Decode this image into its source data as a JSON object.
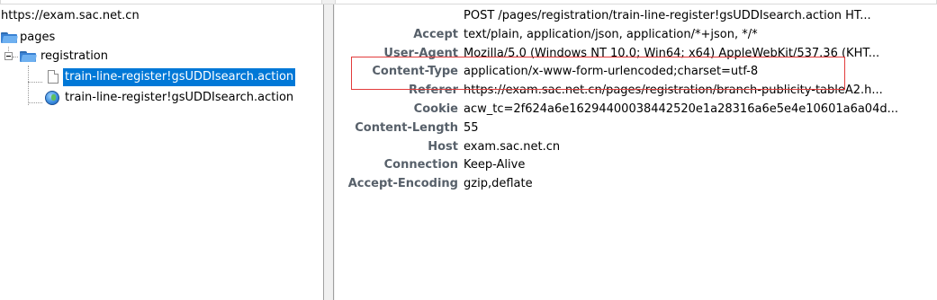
{
  "tree": {
    "root_label": "https://exam.sac.net.cn",
    "folder_pages": "pages",
    "folder_registration": "registration",
    "item_selected": "train-line-register!gsUDDIsearch.action",
    "item_second": "train-line-register!gsUDDIsearch.action"
  },
  "headers": [
    {
      "name": "",
      "value": "POST /pages/registration/train-line-register!gsUDDIsearch.action HT..."
    },
    {
      "name": "Accept",
      "value": "text/plain, application/json, application/*+json, */*"
    },
    {
      "name": "User-Agent",
      "value": "Mozilla/5.0 (Windows NT 10.0; Win64; x64) AppleWebKit/537.36 (KHT..."
    },
    {
      "name": "Content-Type",
      "value": "application/x-www-form-urlencoded;charset=utf-8"
    },
    {
      "name": "Referer",
      "value": "https://exam.sac.net.cn/pages/registration/branch-publicity-tableA2.h..."
    },
    {
      "name": "Cookie",
      "value": "acw_tc=2f624a6e16294400038442520e1a28316a6e5e4e10601a6a04d..."
    },
    {
      "name": "Content-Length",
      "value": "55"
    },
    {
      "name": "Host",
      "value": "exam.sac.net.cn"
    },
    {
      "name": "Connection",
      "value": "Keep-Alive"
    },
    {
      "name": "Accept-Encoding",
      "value": "gzip,deflate"
    }
  ],
  "colors": {
    "selection": "#0078d7",
    "header_name": "#57606a",
    "annotation_box": "#e23b3b"
  }
}
